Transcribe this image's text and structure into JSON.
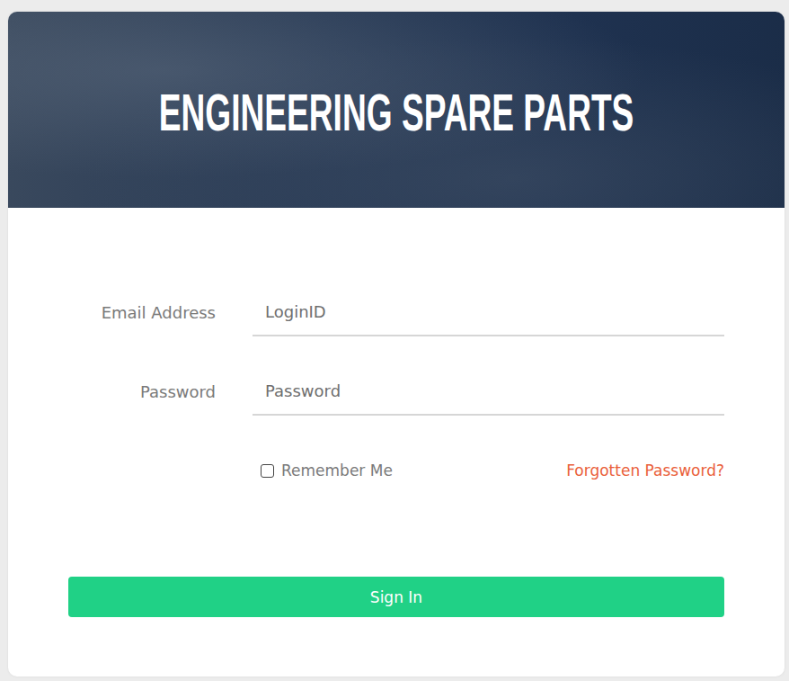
{
  "header": {
    "title": "ENGINEERING SPARE PARTS"
  },
  "fields": [
    {
      "label": "Email Address",
      "placeholder": "LoginID",
      "kind": "text"
    },
    {
      "label": "Password",
      "placeholder": "Password",
      "kind": "password"
    }
  ],
  "remember": {
    "label": "Remember Me",
    "checked": false
  },
  "forgot_link": "Forgotten Password?",
  "button": "Sign In"
}
